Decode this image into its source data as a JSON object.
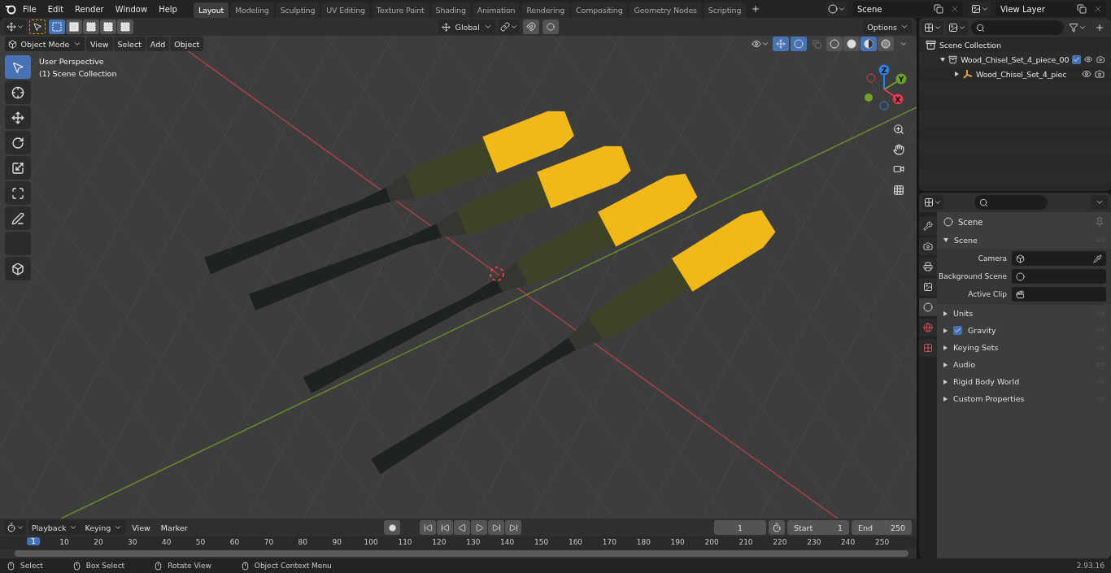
{
  "menu": [
    "File",
    "Edit",
    "Render",
    "Window",
    "Help"
  ],
  "workspaces": [
    {
      "label": "Layout",
      "selected": true
    },
    {
      "label": "Modeling",
      "selected": false
    },
    {
      "label": "Sculpting",
      "selected": false
    },
    {
      "label": "UV Editing",
      "selected": false
    },
    {
      "label": "Texture Paint",
      "selected": false
    },
    {
      "label": "Shading",
      "selected": false
    },
    {
      "label": "Animation",
      "selected": false
    },
    {
      "label": "Rendering",
      "selected": false
    },
    {
      "label": "Compositing",
      "selected": false
    },
    {
      "label": "Geometry Nodes",
      "selected": false
    },
    {
      "label": "Scripting",
      "selected": false
    }
  ],
  "scene": "Scene",
  "view_layer": "View Layer",
  "viewport": {
    "select_modes": [
      {
        "selected": true
      },
      {
        "selected": false
      },
      {
        "selected": false
      },
      {
        "selected": false
      },
      {
        "selected": false
      }
    ],
    "orientation": "Global",
    "options": "Options",
    "mode": "Object Mode",
    "menus": [
      "View",
      "Select",
      "Add",
      "Object"
    ],
    "shading": [
      {
        "kind": "wireframe",
        "selected": false
      },
      {
        "kind": "solid",
        "selected": false
      },
      {
        "kind": "material",
        "selected": true
      },
      {
        "kind": "rendered",
        "selected": false
      }
    ],
    "overlay_text": [
      "User Perspective",
      "(1) Scene Collection"
    ],
    "tools": [
      {
        "kind": "select",
        "selected": true
      },
      {
        "kind": "cursor",
        "selected": false
      },
      {
        "kind": "move",
        "selected": false
      },
      {
        "kind": "rotate",
        "selected": false
      },
      {
        "kind": "scale",
        "selected": false
      },
      {
        "kind": "transform",
        "selected": false
      },
      {
        "kind": "annotate",
        "selected": false
      },
      {
        "kind": "measure",
        "selected": false
      },
      {
        "kind": "add_cube",
        "selected": false
      }
    ],
    "axes": [
      {
        "label": "Z",
        "color": "#2f7fe0"
      },
      {
        "label": "Y",
        "color": "#6ea12a"
      },
      {
        "label": "X",
        "color": "#e0384f"
      }
    ]
  },
  "outliner": {
    "items": [
      {
        "label": "Scene Collection",
        "children": [
          {
            "label": "Wood_Chisel_Set_4_piece_00",
            "checked": true,
            "expanded": true,
            "children": [
              {
                "label": "Wood_Chisel_Set_4_piec",
                "expanded": false
              }
            ]
          }
        ]
      }
    ]
  },
  "properties": {
    "tabs": [
      {
        "kind": "tool",
        "selected": false
      },
      {
        "kind": "render",
        "selected": false
      },
      {
        "kind": "output",
        "selected": false
      },
      {
        "kind": "view_layer",
        "selected": false
      },
      {
        "kind": "scene",
        "selected": true
      },
      {
        "kind": "world",
        "selected": false
      },
      {
        "kind": "texture",
        "selected": false
      }
    ],
    "context": "Scene",
    "panel": {
      "title": "Scene",
      "expanded": true,
      "fields": [
        {
          "label": "Camera",
          "kind": "camera"
        },
        {
          "label": "Background Scene",
          "kind": "scene"
        },
        {
          "label": "Active Clip",
          "kind": "clip"
        }
      ]
    },
    "subpanels": [
      {
        "label": "Units"
      },
      {
        "label": "Gravity",
        "checked": true
      },
      {
        "label": "Keying Sets"
      },
      {
        "label": "Audio"
      },
      {
        "label": "Rigid Body World"
      },
      {
        "label": "Custom Properties"
      }
    ]
  },
  "timeline": {
    "menus": [
      "Playback",
      "Keying"
    ],
    "plain_menus": [
      "View",
      "Marker"
    ],
    "current_frame": "1",
    "start_label": "Start",
    "start": "1",
    "end_label": "End",
    "end": "250",
    "ruler": [
      "1",
      "10",
      "20",
      "30",
      "40",
      "50",
      "60",
      "70",
      "80",
      "90",
      "100",
      "110",
      "120",
      "130",
      "140",
      "150",
      "160",
      "170",
      "180",
      "190",
      "200",
      "210",
      "220",
      "230",
      "240",
      "250"
    ]
  },
  "status": {
    "hints": [
      "Select",
      "Box Select",
      "Rotate View",
      "Object Context Menu"
    ],
    "version": "2.93.16"
  }
}
